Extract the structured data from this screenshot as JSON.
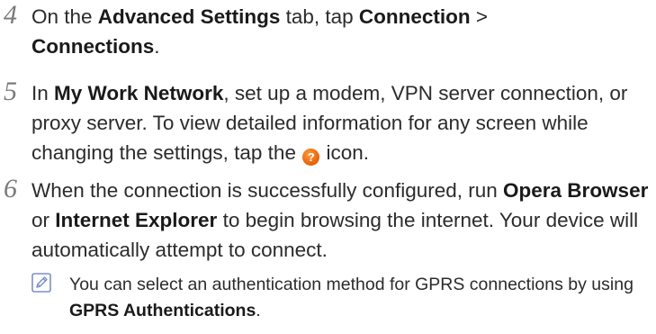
{
  "steps": [
    {
      "number": "4",
      "t1": "On the ",
      "b1": "Advanced Settings",
      "t2": " tab, tap ",
      "b2": "Connection",
      "t3": " > ",
      "b3": "Connections",
      "t4": "."
    },
    {
      "number": "5",
      "t1": "In ",
      "b1": "My Work Network",
      "t2": ", set up a modem, VPN server connection, or proxy server. To view detailed information for any screen while changing the settings, tap the ",
      "icon_glyph": "?",
      "t3": " icon."
    },
    {
      "number": "6",
      "t1": "When the connection is successfully configured, run ",
      "b1": "Opera Browser",
      "t2": " or ",
      "b2": "Internet Explorer",
      "t3": " to begin browsing the internet. Your device will automatically attempt to connect."
    }
  ],
  "note": {
    "icon": "note-pencil-icon",
    "t1": "You can select an authentication method for GPRS connections by using ",
    "b1": "GPRS Authentications",
    "t2": "."
  },
  "colors": {
    "text": "#2b2b2b",
    "step_number": "#7a7a7a",
    "help_icon": "#e8680c",
    "note_icon": "#7d8fc7"
  }
}
